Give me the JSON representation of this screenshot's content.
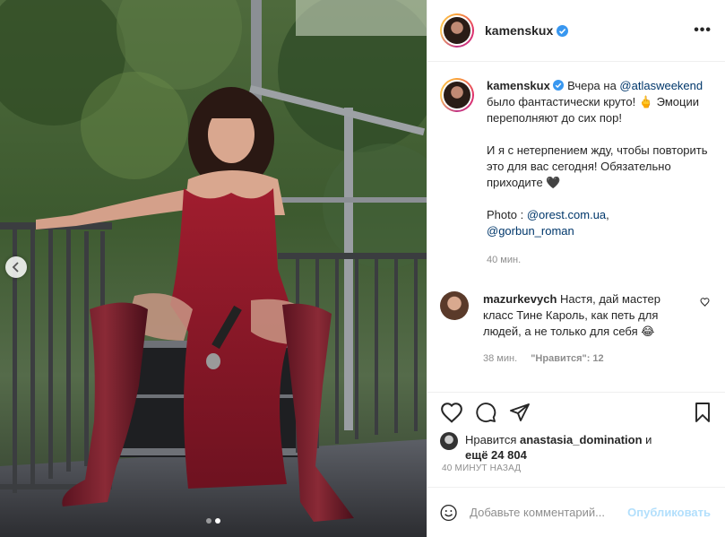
{
  "post": {
    "username": "kamenskux",
    "more_label": "•••"
  },
  "caption": {
    "username": "kamenskux",
    "text_1": "Вчера на ",
    "mention_1": "@atlasweekend",
    "text_2": " было фантастически круто! ",
    "emoji_1": "🖕",
    "text_3": " Эмоции переполняют до сих пор!",
    "para_2": "И я с нетерпением жду, чтобы повторить это для вас сегодня! Обязательно приходите ",
    "emoji_2": "🖤",
    "photo_prefix": "Photo : ",
    "mention_2": "@orest.com.ua",
    "mention_sep": ",",
    "mention_3": "@gorbun_roman",
    "time": "40 мин."
  },
  "comment": {
    "username": "mazurkevych",
    "text": " Настя, дай мастер класс Тине Кароль, как петь для людей, а не только для себя ",
    "emoji": "😂",
    "time": "38 мин.",
    "likes_label": "\"Нравится\": 12"
  },
  "likes": {
    "prefix": "Нравится ",
    "user": "anastasia_domination",
    "and": " и",
    "others": "ещё 24 804"
  },
  "timestamp": "40 МИНУТ НАЗАД",
  "add_comment": {
    "placeholder": "Добавьте комментарий...",
    "publish": "Опубликовать"
  },
  "carousel": {
    "slides": 2,
    "active": 2
  },
  "icons": {
    "header_avatar": "avatar-icon",
    "verified": "verified-badge-icon",
    "like": "heart-icon",
    "comment": "comment-icon",
    "share": "paper-plane-icon",
    "save": "bookmark-icon",
    "emoji": "smiley-icon",
    "prev": "chevron-left-icon"
  },
  "colors": {
    "verified": "#3897f0",
    "link": "#00376b",
    "publish": "#b2dffc",
    "muted": "#8e8e8e"
  }
}
